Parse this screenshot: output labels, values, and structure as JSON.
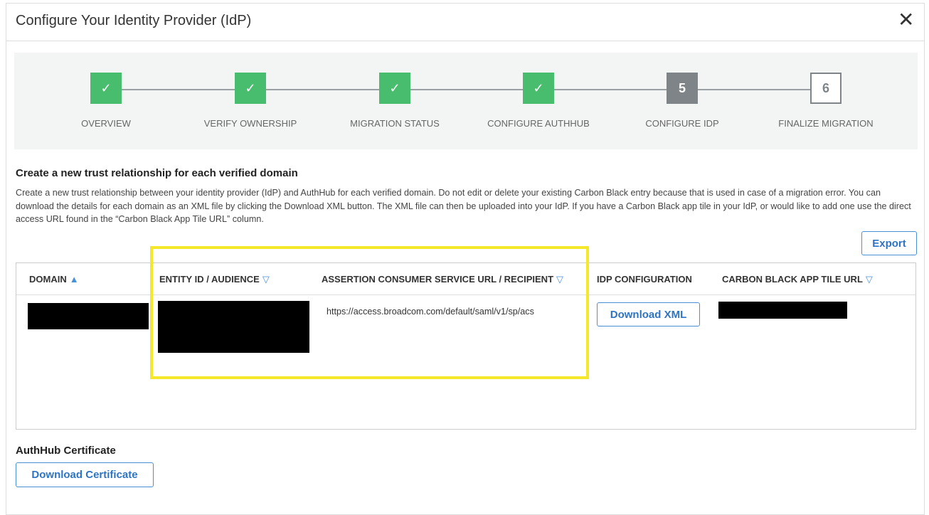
{
  "dialog": {
    "title": "Configure Your Identity Provider (IdP)",
    "close_icon": "close-icon"
  },
  "stepper": {
    "steps": [
      {
        "label": "OVERVIEW",
        "marker": "✓",
        "state": "done"
      },
      {
        "label": "VERIFY OWNERSHIP",
        "marker": "✓",
        "state": "done"
      },
      {
        "label": "MIGRATION STATUS",
        "marker": "✓",
        "state": "done"
      },
      {
        "label": "CONFIGURE AUTHHUB",
        "marker": "✓",
        "state": "done"
      },
      {
        "label": "CONFIGURE IDP",
        "marker": "5",
        "state": "current"
      },
      {
        "label": "FINALIZE MIGRATION",
        "marker": "6",
        "state": "upcoming"
      }
    ]
  },
  "section": {
    "heading": "Create a new trust relationship for each verified domain",
    "description": "Create a new trust relationship between your identity provider (IdP) and AuthHub for each verified domain. Do not edit or delete your existing Carbon Black entry because that is used in case of a migration error. You can download the details for each domain as an XML file by clicking the Download XML button. The XML file can then be uploaded into your IdP. If you have a Carbon Black app tile in your IdP, or would like to add one use the direct access URL found in the “Carbon Black App Tile URL” column."
  },
  "export_label": "Export",
  "table": {
    "columns": [
      {
        "label": "DOMAIN",
        "sort": "▲"
      },
      {
        "label": "ENTITY ID / AUDIENCE",
        "sort": "▽"
      },
      {
        "label": "ASSERTION CONSUMER SERVICE URL / RECIPIENT",
        "sort": "▽"
      },
      {
        "label": "IDP CONFIGURATION",
        "sort": ""
      },
      {
        "label": "CARBON BLACK APP TILE URL",
        "sort": "▽"
      }
    ],
    "rows": [
      {
        "acs_url": "https://access.broadcom.com/default/saml/v1/sp/acs",
        "action": "Download XML"
      }
    ]
  },
  "certificate": {
    "label": "AuthHub Certificate",
    "button": "Download Certificate"
  },
  "colors": {
    "done": "#48bd6e",
    "current": "#7f8488",
    "highlight": "#f5e72a",
    "accent": "#2d74c4"
  }
}
